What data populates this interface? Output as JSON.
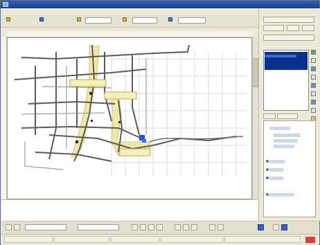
{
  "window": {
    "title": ""
  },
  "menubar": {
    "items": [
      "",
      "",
      "",
      "",
      "",
      "",
      "",
      ""
    ]
  },
  "toolbar": {
    "buttons": [
      {
        "icon": "folder-icon"
      },
      {
        "icon": "save-icon"
      },
      {
        "icon": "print-icon"
      },
      {
        "icon": "pointer-icon"
      },
      {
        "icon": "zoom-icon"
      }
    ]
  },
  "map": {
    "background": "#ffffff",
    "road_color": "#5a5a5a",
    "highlight_color": "#f0e8a8",
    "marker_color": "#2a4fd8",
    "grid_color": "#d8d8e8",
    "callouts": [
      {
        "name": "callout-1",
        "text": ""
      },
      {
        "name": "callout-2",
        "text": ""
      },
      {
        "name": "callout-3",
        "text": ""
      }
    ]
  },
  "right_panel": {
    "header": "",
    "selected_item": "",
    "tabs": [
      "",
      ""
    ],
    "tree_items": [
      "",
      "",
      "",
      "",
      "",
      "",
      "",
      ""
    ],
    "accent": "#0b2f8c"
  },
  "statusbar": {
    "cells": [
      "",
      "",
      "",
      "",
      ""
    ]
  }
}
